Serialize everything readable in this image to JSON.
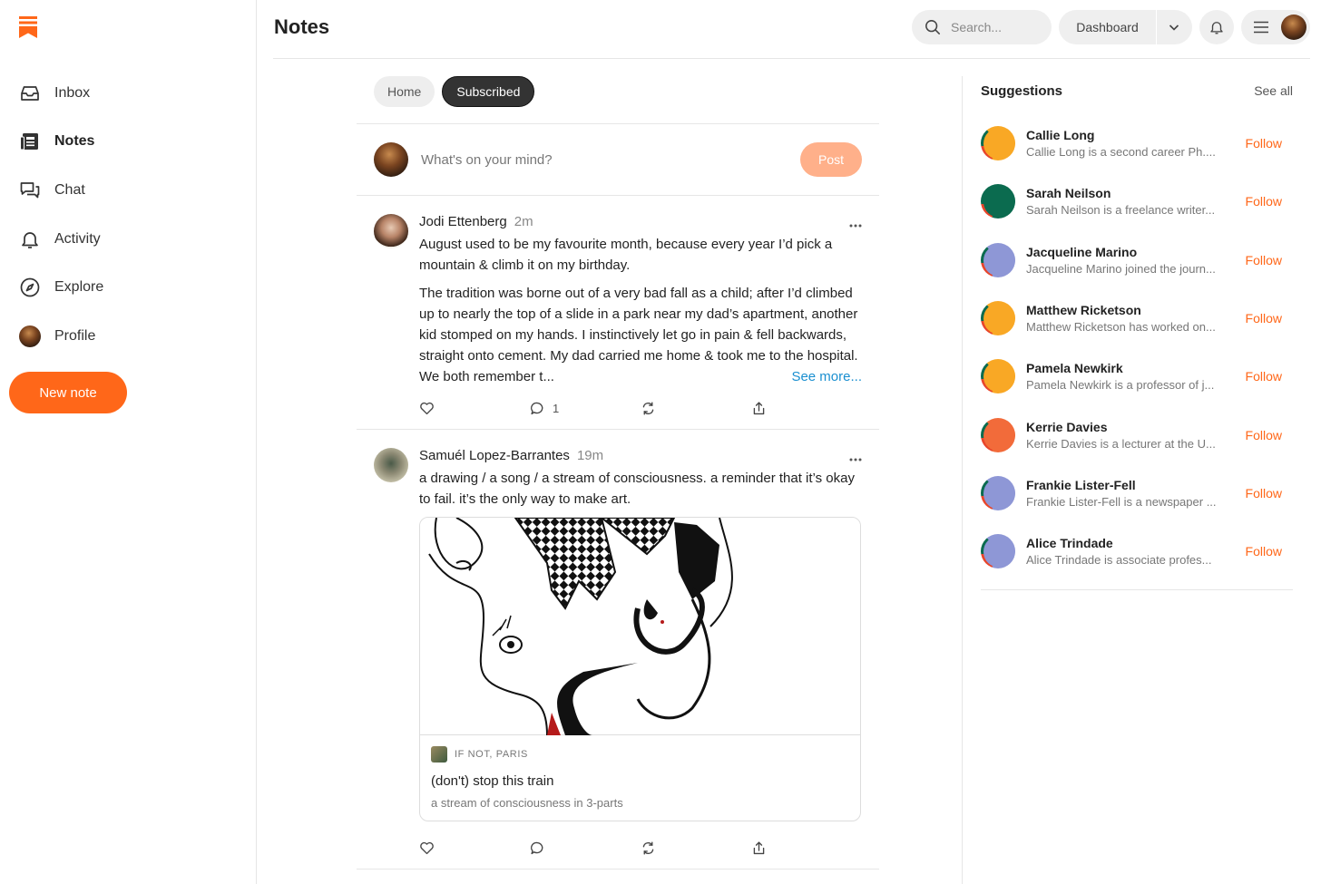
{
  "header": {
    "title": "Notes",
    "search_placeholder": "Search...",
    "dashboard_label": "Dashboard"
  },
  "sidebar": {
    "items": [
      {
        "label": "Inbox",
        "icon": "inbox-icon"
      },
      {
        "label": "Notes",
        "icon": "notes-icon",
        "active": true
      },
      {
        "label": "Chat",
        "icon": "chat-icon"
      },
      {
        "label": "Activity",
        "icon": "bell-icon"
      },
      {
        "label": "Explore",
        "icon": "compass-icon"
      },
      {
        "label": "Profile",
        "icon": "avatar"
      }
    ],
    "new_note_label": "New note"
  },
  "feed": {
    "tabs": [
      {
        "label": "Home",
        "active": false
      },
      {
        "label": "Subscribed",
        "active": true
      }
    ],
    "composer": {
      "placeholder": "What's on your mind?",
      "post_label": "Post"
    },
    "notes": [
      {
        "author": "Jodi Ettenberg",
        "time": "2m",
        "paragraph1": "August used to be my favourite month, because every year I’d pick a mountain & climb it on my birthday.",
        "paragraph2": "The tradition was borne out of a very bad fall as a child; after I’d climbed up to nearly the top of a slide in a park near my dad’s apartment, another kid stomped on my hands. I instinctively let go in pain & fell backwards, straight onto cement. My dad carried me home & took me to the hospital. We both remember t...",
        "see_more": "See more...",
        "comments": "1"
      },
      {
        "author": "Samuél Lopez-Barrantes",
        "time": "19m",
        "paragraph1": "a drawing / a song / a stream of consciousness. a reminder that it’s okay to fail. it’s the only way to make art.",
        "embed": {
          "publication": "IF NOT, PARIS",
          "title": "(don't) stop this train",
          "subtitle": "a stream of consciousness in 3-parts"
        }
      }
    ]
  },
  "suggestions": {
    "title": "Suggestions",
    "see_all": "See all",
    "follow_label": "Follow",
    "items": [
      {
        "name": "Callie Long",
        "desc": "Callie Long is a second career Ph....",
        "color": "#f9a825"
      },
      {
        "name": "Sarah Neilson",
        "desc": "Sarah Neilson is a freelance writer...",
        "color": "#0b6b4f"
      },
      {
        "name": "Jacqueline Marino",
        "desc": "Jacqueline Marino joined the journ...",
        "color": "#8e97d6"
      },
      {
        "name": "Matthew Ricketson",
        "desc": "Matthew Ricketson has worked on...",
        "color": "#f9a825"
      },
      {
        "name": "Pamela Newkirk",
        "desc": "Pamela Newkirk is a professor of j...",
        "color": "#f9a825"
      },
      {
        "name": "Kerrie Davies",
        "desc": "Kerrie Davies is a lecturer at the U...",
        "color": "#f26b3a"
      },
      {
        "name": "Frankie Lister-Fell",
        "desc": "Frankie Lister-Fell is a newspaper ...",
        "color": "#8e97d6"
      },
      {
        "name": "Alice Trindade",
        "desc": "Alice Trindade is associate profes...",
        "color": "#8e97d6"
      }
    ]
  },
  "colors": {
    "accent": "#ff6719",
    "link": "#1a8fd0"
  }
}
